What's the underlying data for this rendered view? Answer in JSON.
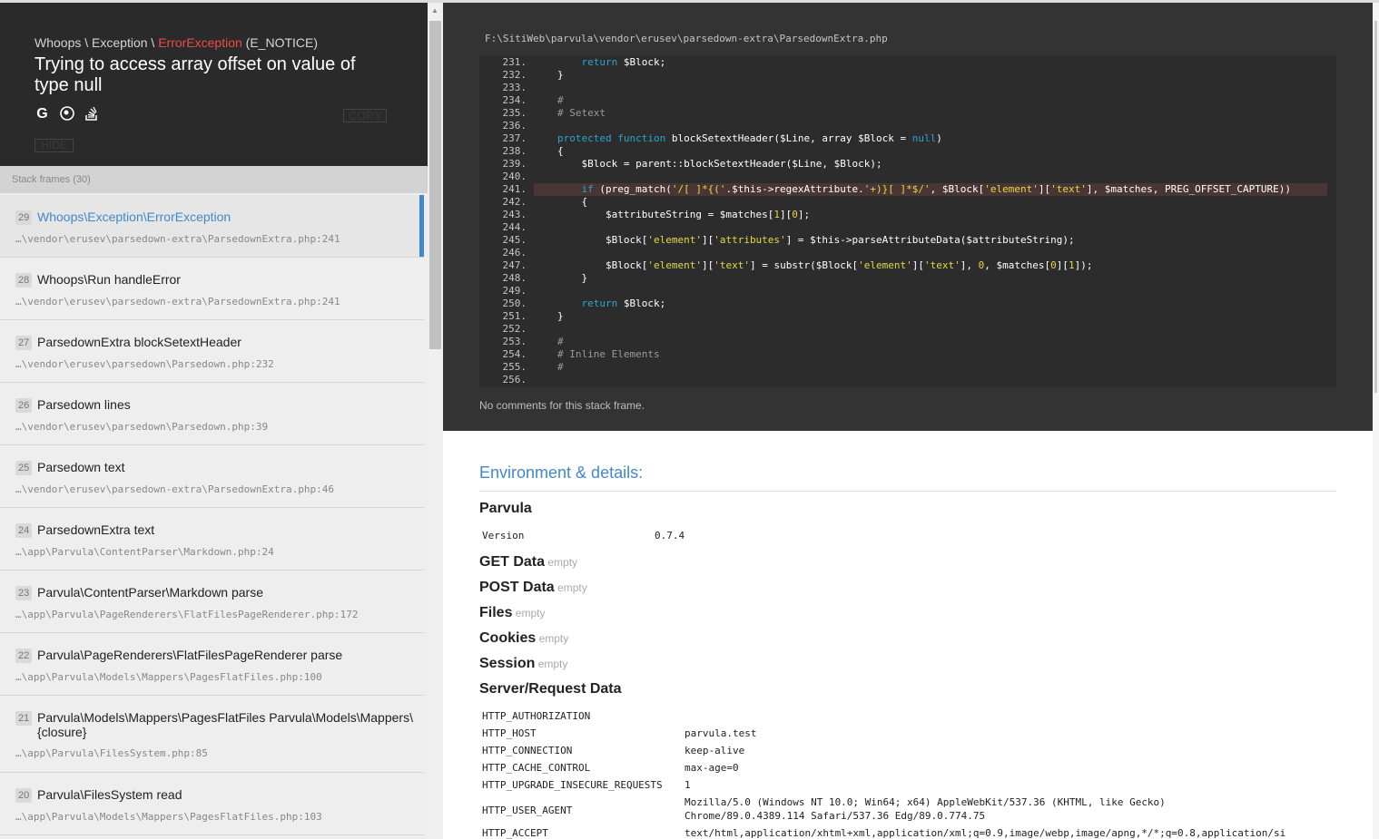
{
  "exception": {
    "crumb_1": "Whoops",
    "crumb_sep": " \\ ",
    "crumb_2": "Exception",
    "crumb_3": "ErrorException",
    "crumb_4": "(E_NOTICE)",
    "message": "Trying to access array offset on value of type null",
    "copy_label": "COPY",
    "hide_label": "HIDE",
    "icons": [
      "google-icon",
      "duckduckgo-icon",
      "stackoverflow-icon"
    ]
  },
  "frames": {
    "header": "Stack frames (30)",
    "items": [
      {
        "num": "29",
        "title": "Whoops\\Exception\\ErrorException",
        "file": "…\\vendor\\erusev\\parsedown-extra\\ParsedownExtra.php:241"
      },
      {
        "num": "28",
        "title": "Whoops\\Run handleError",
        "file": "…\\vendor\\erusev\\parsedown-extra\\ParsedownExtra.php:241"
      },
      {
        "num": "27",
        "title": "ParsedownExtra blockSetextHeader",
        "file": "…\\vendor\\erusev\\parsedown\\Parsedown.php:232"
      },
      {
        "num": "26",
        "title": "Parsedown lines",
        "file": "…\\vendor\\erusev\\parsedown\\Parsedown.php:39"
      },
      {
        "num": "25",
        "title": "Parsedown text",
        "file": "…\\vendor\\erusev\\parsedown-extra\\ParsedownExtra.php:46"
      },
      {
        "num": "24",
        "title": "ParsedownExtra text",
        "file": "…\\app\\Parvula\\ContentParser\\Markdown.php:24"
      },
      {
        "num": "23",
        "title": "Parvula\\ContentParser\\Markdown parse",
        "file": "…\\app\\Parvula\\PageRenderers\\FlatFilesPageRenderer.php:172"
      },
      {
        "num": "22",
        "title": "Parvula\\PageRenderers\\FlatFilesPageRenderer parse",
        "file": "…\\app\\Parvula\\Models\\Mappers\\PagesFlatFiles.php:100"
      },
      {
        "num": "21",
        "title": "Parvula\\Models\\Mappers\\PagesFlatFiles Parvula\\Models\\Mappers\\{closure}",
        "file": "…\\app\\Parvula\\FilesSystem.php:85"
      },
      {
        "num": "20",
        "title": "Parvula\\FilesSystem read",
        "file": "…\\app\\Parvula\\Models\\Mappers\\PagesFlatFiles.php:103"
      }
    ]
  },
  "code": {
    "file_path": "F:\\SitiWeb\\parvula\\vendor\\erusev\\parsedown-extra\\ParsedownExtra.php",
    "no_comments": "No comments for this stack frame.",
    "lines": [
      {
        "n": "231.",
        "t": "    return $Block;"
      },
      {
        "n": "232.",
        "t": "}"
      },
      {
        "n": "233.",
        "t": ""
      },
      {
        "n": "234.",
        "t": "#"
      },
      {
        "n": "235.",
        "t": "# Setext"
      },
      {
        "n": "236.",
        "t": ""
      },
      {
        "n": "237.",
        "t": "protected function blockSetextHeader($Line, array $Block = null)"
      },
      {
        "n": "238.",
        "t": "{"
      },
      {
        "n": "239.",
        "t": "    $Block = parent::blockSetextHeader($Line, $Block);"
      },
      {
        "n": "240.",
        "t": ""
      },
      {
        "n": "241.",
        "t": "    if (preg_match('/[ ]*{('.$this->regexAttribute.'+)}[ ]*$/', $Block['element']['text'], $matches, PREG_OFFSET_CAPTURE))"
      },
      {
        "n": "242.",
        "t": "    {"
      },
      {
        "n": "243.",
        "t": "        $attributeString = $matches[1][0];"
      },
      {
        "n": "244.",
        "t": ""
      },
      {
        "n": "245.",
        "t": "        $Block['element']['attributes'] = $this->parseAttributeData($attributeString);"
      },
      {
        "n": "246.",
        "t": ""
      },
      {
        "n": "247.",
        "t": "        $Block['element']['text'] = substr($Block['element']['text'], 0, $matches[0][1]);"
      },
      {
        "n": "248.",
        "t": "    }"
      },
      {
        "n": "249.",
        "t": ""
      },
      {
        "n": "250.",
        "t": "    return $Block;"
      },
      {
        "n": "251.",
        "t": "}"
      },
      {
        "n": "252.",
        "t": ""
      },
      {
        "n": "253.",
        "t": "#"
      },
      {
        "n": "254.",
        "t": "# Inline Elements"
      },
      {
        "n": "255.",
        "t": "#"
      },
      {
        "n": "256.",
        "t": ""
      }
    ]
  },
  "env": {
    "title": "Environment & details:",
    "app_name": "Parvula",
    "version_key": "Version",
    "version_val": "0.7.4",
    "empty_label": "empty",
    "sections": [
      "GET Data",
      "POST Data",
      "Files",
      "Cookies",
      "Session"
    ],
    "server_title": "Server/Request Data",
    "server": [
      {
        "k": "HTTP_AUTHORIZATION",
        "v": ""
      },
      {
        "k": "HTTP_HOST",
        "v": "parvula.test"
      },
      {
        "k": "HTTP_CONNECTION",
        "v": "keep-alive"
      },
      {
        "k": "HTTP_CACHE_CONTROL",
        "v": "max-age=0"
      },
      {
        "k": "HTTP_UPGRADE_INSECURE_REQUESTS",
        "v": "1"
      },
      {
        "k": "HTTP_USER_AGENT",
        "v": "Mozilla/5.0 (Windows NT 10.0; Win64; x64) AppleWebKit/537.36 (KHTML, like Gecko)\nChrome/89.0.4389.114 Safari/537.36 Edg/89.0.774.75"
      },
      {
        "k": "HTTP_ACCEPT",
        "v": "text/html,application/xhtml+xml,application/xml;q=0.9,image/webp,image/apng,*/*;q=0.8,application/si"
      }
    ]
  },
  "colors": {
    "accent": "#4288ce",
    "error": "#e94b4b",
    "dark_bg": "#2a2a2a"
  }
}
